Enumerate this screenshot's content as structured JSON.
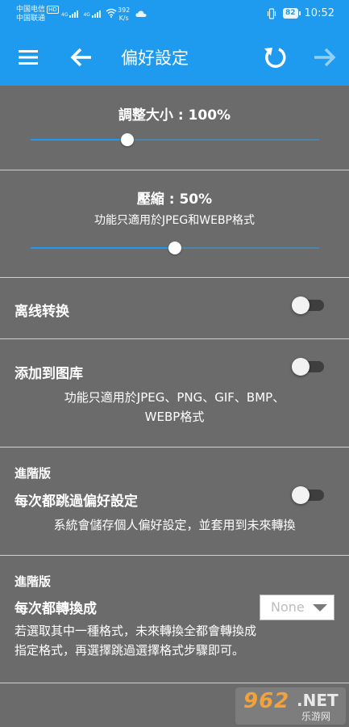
{
  "status_bar": {
    "carrier1": "中国电信",
    "carrier1_badge": "HD",
    "carrier2": "中国联通",
    "net_gen1": "4G",
    "net_gen2": "4G",
    "speed_value": "392",
    "speed_unit": "K/s",
    "battery": "82",
    "time": "10:52"
  },
  "app_bar": {
    "title": "偏好設定",
    "accent": "#1e9bef"
  },
  "resize": {
    "label": "調整大小 : 100%",
    "value": 0.335
  },
  "compress": {
    "label": "壓縮 : 50%",
    "note": "功能只適用於JPEG和WEBP格式",
    "value": 0.5
  },
  "offline": {
    "label": "离线转换",
    "enabled": false
  },
  "gallery": {
    "label": "添加到图库",
    "note_line1": "功能只適用於JPEG、PNG、GIF、BMP、",
    "note_line2": "WEBP格式",
    "enabled": false
  },
  "skip_pref": {
    "badge": "進階版",
    "label": "每次都跳過偏好設定",
    "note": "系統會儲存個人偏好設定，並套用到未來轉換",
    "enabled": false
  },
  "always_convert": {
    "badge": "進階版",
    "label": "每次都轉換成",
    "selected": "None",
    "note_line1": "若選取其中一種格式，未來轉換全都會轉換成",
    "note_line2": "指定格式，再選擇跳過選擇格式步驟即可。"
  },
  "watermark": {
    "number": "962",
    "suffix": ".NET",
    "site": "乐游网"
  }
}
